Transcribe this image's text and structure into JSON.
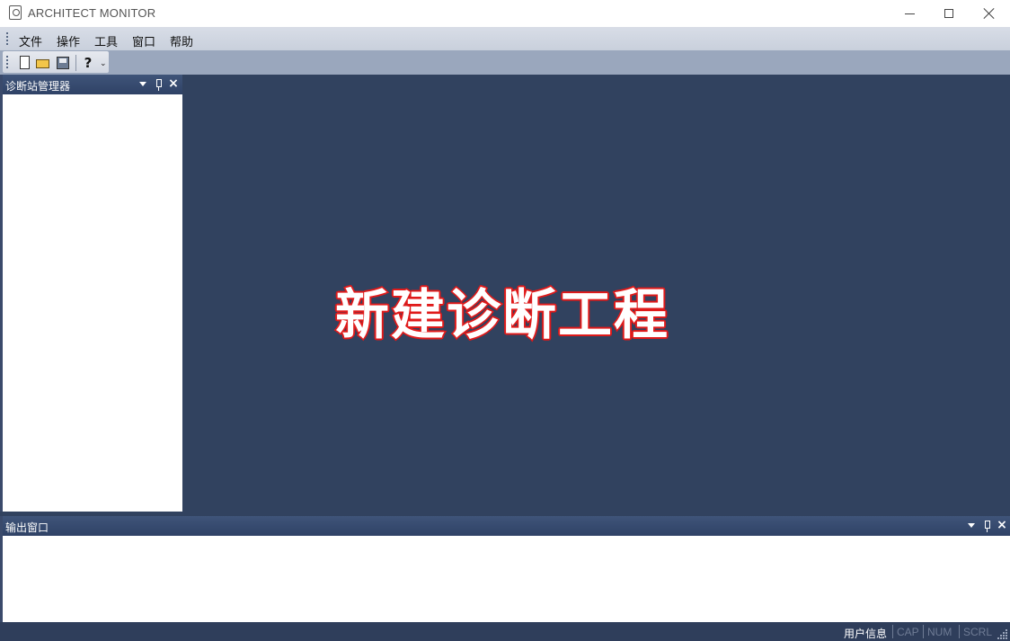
{
  "window": {
    "title": "ARCHITECT MONITOR"
  },
  "menu": [
    "文件",
    "操作",
    "工具",
    "窗口",
    "帮助"
  ],
  "toolbar": {
    "help_glyph": "?",
    "more_glyph": "⌄"
  },
  "side_panel": {
    "title": "诊断站管理器"
  },
  "main": {
    "overlay_text": "新建诊断工程",
    "background": "#31425f"
  },
  "output_panel": {
    "title": "输出窗口"
  },
  "statusbar": {
    "user_info": "用户信息",
    "cap": "CAP",
    "num": "NUM",
    "scrl": "SCRL"
  },
  "colors": {
    "panel_header": "#3f5479",
    "overlay_stroke": "#e01b1b",
    "statusbar": "#2f3e5b"
  }
}
